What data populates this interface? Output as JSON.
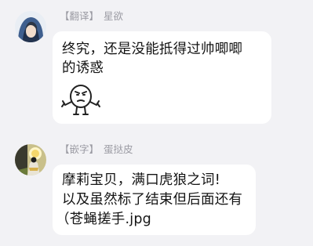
{
  "messages": [
    {
      "role_tag": "【翻译】",
      "sender": "星欲",
      "lines": [
        "终究，还是没能抵得过帅唧唧",
        "的诱惑"
      ],
      "sticker": "shrug-face-sticker"
    },
    {
      "role_tag": "【嵌字】",
      "sender": "蛋挞皮",
      "lines": [
        "摩莉宝贝，满口虎狼之词!",
        "以及虽然标了结束但后面还有",
        "（苍蝇搓手.jpg"
      ]
    }
  ]
}
